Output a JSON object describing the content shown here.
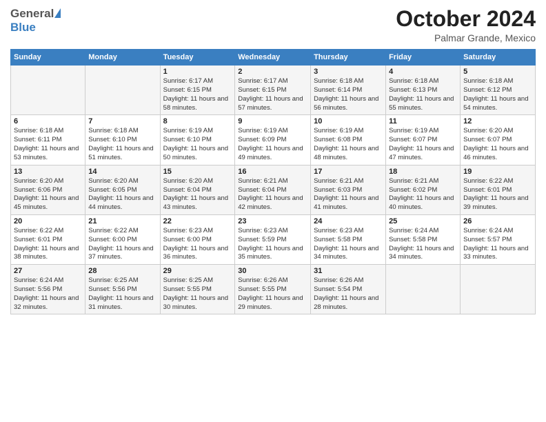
{
  "logo": {
    "general": "General",
    "blue": "Blue"
  },
  "header": {
    "month": "October 2024",
    "location": "Palmar Grande, Mexico"
  },
  "weekdays": [
    "Sunday",
    "Monday",
    "Tuesday",
    "Wednesday",
    "Thursday",
    "Friday",
    "Saturday"
  ],
  "weeks": [
    [
      {
        "day": "",
        "info": ""
      },
      {
        "day": "",
        "info": ""
      },
      {
        "day": "1",
        "sunrise": "6:17 AM",
        "sunset": "6:15 PM",
        "daylight": "11 hours and 58 minutes."
      },
      {
        "day": "2",
        "sunrise": "6:17 AM",
        "sunset": "6:15 PM",
        "daylight": "11 hours and 57 minutes."
      },
      {
        "day": "3",
        "sunrise": "6:18 AM",
        "sunset": "6:14 PM",
        "daylight": "11 hours and 56 minutes."
      },
      {
        "day": "4",
        "sunrise": "6:18 AM",
        "sunset": "6:13 PM",
        "daylight": "11 hours and 55 minutes."
      },
      {
        "day": "5",
        "sunrise": "6:18 AM",
        "sunset": "6:12 PM",
        "daylight": "11 hours and 54 minutes."
      }
    ],
    [
      {
        "day": "6",
        "sunrise": "6:18 AM",
        "sunset": "6:11 PM",
        "daylight": "11 hours and 53 minutes."
      },
      {
        "day": "7",
        "sunrise": "6:18 AM",
        "sunset": "6:10 PM",
        "daylight": "11 hours and 51 minutes."
      },
      {
        "day": "8",
        "sunrise": "6:19 AM",
        "sunset": "6:10 PM",
        "daylight": "11 hours and 50 minutes."
      },
      {
        "day": "9",
        "sunrise": "6:19 AM",
        "sunset": "6:09 PM",
        "daylight": "11 hours and 49 minutes."
      },
      {
        "day": "10",
        "sunrise": "6:19 AM",
        "sunset": "6:08 PM",
        "daylight": "11 hours and 48 minutes."
      },
      {
        "day": "11",
        "sunrise": "6:19 AM",
        "sunset": "6:07 PM",
        "daylight": "11 hours and 47 minutes."
      },
      {
        "day": "12",
        "sunrise": "6:20 AM",
        "sunset": "6:07 PM",
        "daylight": "11 hours and 46 minutes."
      }
    ],
    [
      {
        "day": "13",
        "sunrise": "6:20 AM",
        "sunset": "6:06 PM",
        "daylight": "11 hours and 45 minutes."
      },
      {
        "day": "14",
        "sunrise": "6:20 AM",
        "sunset": "6:05 PM",
        "daylight": "11 hours and 44 minutes."
      },
      {
        "day": "15",
        "sunrise": "6:20 AM",
        "sunset": "6:04 PM",
        "daylight": "11 hours and 43 minutes."
      },
      {
        "day": "16",
        "sunrise": "6:21 AM",
        "sunset": "6:04 PM",
        "daylight": "11 hours and 42 minutes."
      },
      {
        "day": "17",
        "sunrise": "6:21 AM",
        "sunset": "6:03 PM",
        "daylight": "11 hours and 41 minutes."
      },
      {
        "day": "18",
        "sunrise": "6:21 AM",
        "sunset": "6:02 PM",
        "daylight": "11 hours and 40 minutes."
      },
      {
        "day": "19",
        "sunrise": "6:22 AM",
        "sunset": "6:01 PM",
        "daylight": "11 hours and 39 minutes."
      }
    ],
    [
      {
        "day": "20",
        "sunrise": "6:22 AM",
        "sunset": "6:01 PM",
        "daylight": "11 hours and 38 minutes."
      },
      {
        "day": "21",
        "sunrise": "6:22 AM",
        "sunset": "6:00 PM",
        "daylight": "11 hours and 37 minutes."
      },
      {
        "day": "22",
        "sunrise": "6:23 AM",
        "sunset": "6:00 PM",
        "daylight": "11 hours and 36 minutes."
      },
      {
        "day": "23",
        "sunrise": "6:23 AM",
        "sunset": "5:59 PM",
        "daylight": "11 hours and 35 minutes."
      },
      {
        "day": "24",
        "sunrise": "6:23 AM",
        "sunset": "5:58 PM",
        "daylight": "11 hours and 34 minutes."
      },
      {
        "day": "25",
        "sunrise": "6:24 AM",
        "sunset": "5:58 PM",
        "daylight": "11 hours and 34 minutes."
      },
      {
        "day": "26",
        "sunrise": "6:24 AM",
        "sunset": "5:57 PM",
        "daylight": "11 hours and 33 minutes."
      }
    ],
    [
      {
        "day": "27",
        "sunrise": "6:24 AM",
        "sunset": "5:56 PM",
        "daylight": "11 hours and 32 minutes."
      },
      {
        "day": "28",
        "sunrise": "6:25 AM",
        "sunset": "5:56 PM",
        "daylight": "11 hours and 31 minutes."
      },
      {
        "day": "29",
        "sunrise": "6:25 AM",
        "sunset": "5:55 PM",
        "daylight": "11 hours and 30 minutes."
      },
      {
        "day": "30",
        "sunrise": "6:26 AM",
        "sunset": "5:55 PM",
        "daylight": "11 hours and 29 minutes."
      },
      {
        "day": "31",
        "sunrise": "6:26 AM",
        "sunset": "5:54 PM",
        "daylight": "11 hours and 28 minutes."
      },
      {
        "day": "",
        "info": ""
      },
      {
        "day": "",
        "info": ""
      }
    ]
  ],
  "labels": {
    "sunrise_prefix": "Sunrise: ",
    "sunset_prefix": "Sunset: ",
    "daylight_prefix": "Daylight: "
  }
}
